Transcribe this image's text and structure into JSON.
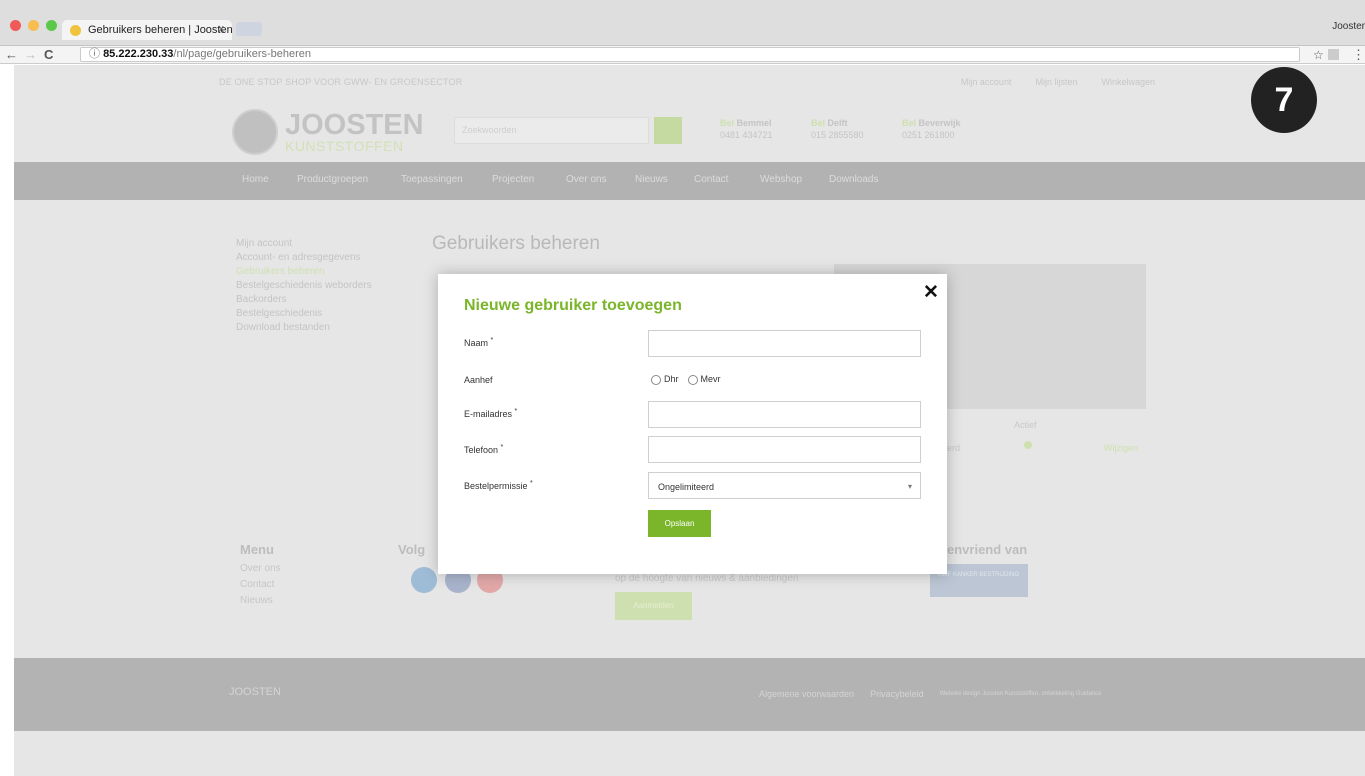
{
  "browser": {
    "tab_title": "Gebruikers beheren | Joosten",
    "tab_close": "x",
    "user_label": "Jooster",
    "back": "←",
    "forward": "→",
    "reload": "C",
    "url_host": "85.222.230.33",
    "url_path": "/nl/page/gebruikers-beheren",
    "star": "☆",
    "menu": "⋮"
  },
  "site": {
    "tagline": "DE ONE STOP SHOP VOOR GWW- EN GROENSECTOR",
    "toplinks": [
      "Mijn account",
      "Mijn lijsten",
      "Winkelwagen"
    ],
    "logo_name": "JOOSTEN",
    "logo_sub": "KUNSTSTOFFEN",
    "search_placeholder": "Zoekwoorden",
    "stores": [
      {
        "label": "Bel",
        "city": "Bemmel",
        "phone": "0481 434721"
      },
      {
        "label": "Bel",
        "city": "Delft",
        "phone": "015 2855580"
      },
      {
        "label": "Bel",
        "city": "Beverwijk",
        "phone": "0251 261800"
      }
    ],
    "nav": [
      "Home",
      "Productgroepen",
      "Toepassingen",
      "Projecten",
      "Over ons",
      "Nieuws",
      "Contact",
      "Webshop",
      "Downloads"
    ],
    "sidebar": [
      "Mijn account",
      "Account- en adresgegevens",
      "Gebruikers beheren",
      "Bestelgeschiedenis weborders",
      "Backorders",
      "Bestelgeschiedenis",
      "Download bestanden"
    ],
    "page_title": "Gebruikers beheren",
    "bg_col1": "Actief",
    "bg_row_val": "erd",
    "bg_row_action": "Wijzigen",
    "footer": {
      "menu_title": "Menu",
      "menu_items": [
        "Over ons",
        "Contact",
        "Nieuws"
      ],
      "follow_title": "Volg",
      "friend_title": "envriend van",
      "newsletter_text": "op de hoogte van nieuws & aanbiedingen",
      "newsletter_button": "Aanmelden",
      "badge_text": "KWF KANKER BESTRIJDING"
    },
    "bottom": {
      "logo": "JOOSTEN",
      "links": [
        "Algemene voorwaarden",
        "Privacybeleid"
      ],
      "credit": "Website design Joosten Kunststoffen, ontwikkeling Guidance"
    }
  },
  "modal": {
    "title": "Nieuwe gebruiker toevoegen",
    "close": "✕",
    "fields": {
      "naam": "Naam",
      "aanhef": "Aanhef",
      "email": "E-mailadres",
      "telefoon": "Telefoon",
      "bestelpermissie": "Bestelpermissie"
    },
    "required_mark": "*",
    "radio_dhr": "Dhr",
    "radio_mevr": "Mevr",
    "select_value": "Ongelimiteerd",
    "save_label": "Opslaan"
  },
  "overlay_badge": "7",
  "colors": {
    "accent": "#7ab52a",
    "overlay": "#e6e6e6"
  }
}
